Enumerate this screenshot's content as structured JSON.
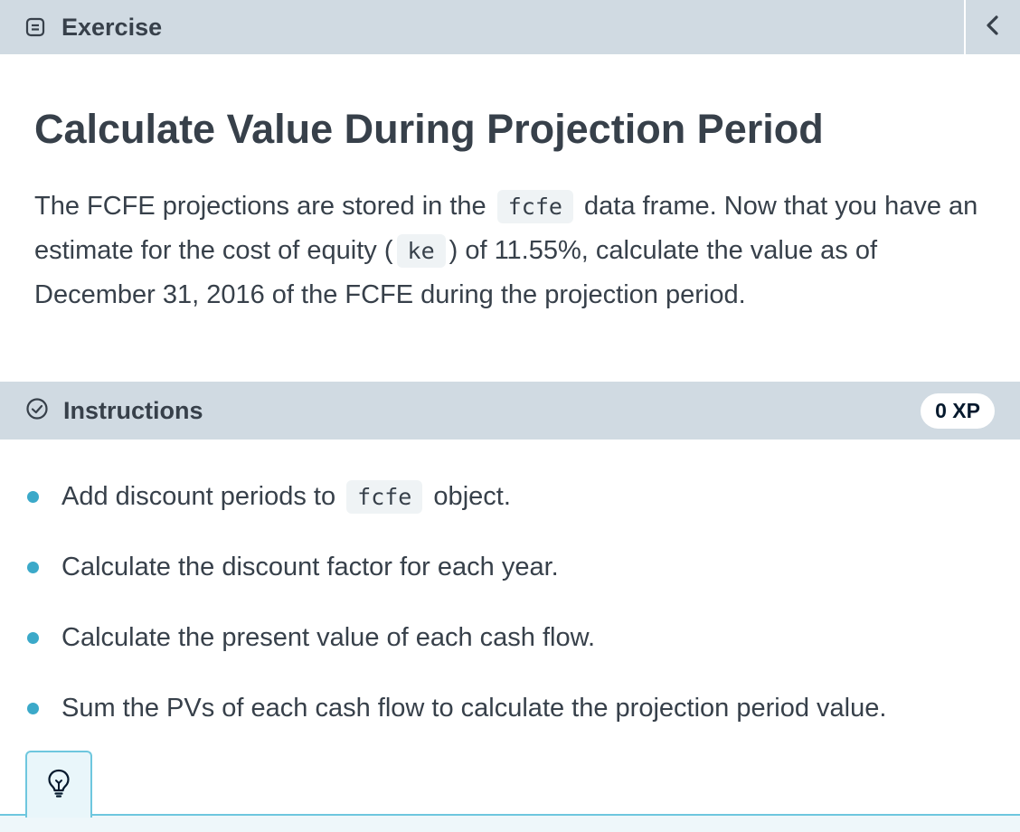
{
  "header": {
    "title": "Exercise",
    "icon": "exercise-icon",
    "collapse_icon": "chevron-left-icon"
  },
  "exercise": {
    "title": "Calculate Value During Projection Period",
    "description": [
      "The FCFE projections are stored in the ",
      "fcfe",
      " data frame. Now that you have an estimate for the cost of equity (",
      "ke",
      ") of 11.55%, calculate the value as of December 31, 2016 of the FCFE during the projection period."
    ]
  },
  "instructions": {
    "title": "Instructions",
    "icon": "check-circle-icon",
    "xp": "0 XP",
    "items": [
      {
        "parts": [
          "Add discount periods to ",
          "fcfe",
          " object."
        ]
      },
      {
        "parts": [
          "Calculate the discount factor for each year."
        ]
      },
      {
        "parts": [
          "Calculate the present value of each cash flow."
        ]
      },
      {
        "parts": [
          "Sum the PVs of each cash flow to calculate the projection period value."
        ]
      }
    ]
  },
  "hint": {
    "icon": "lightbulb-icon"
  },
  "colors": {
    "header_bg": "#d0dae2",
    "bullet": "#3ba9c9",
    "hint_border": "#6ec7de",
    "text": "#37404a"
  }
}
